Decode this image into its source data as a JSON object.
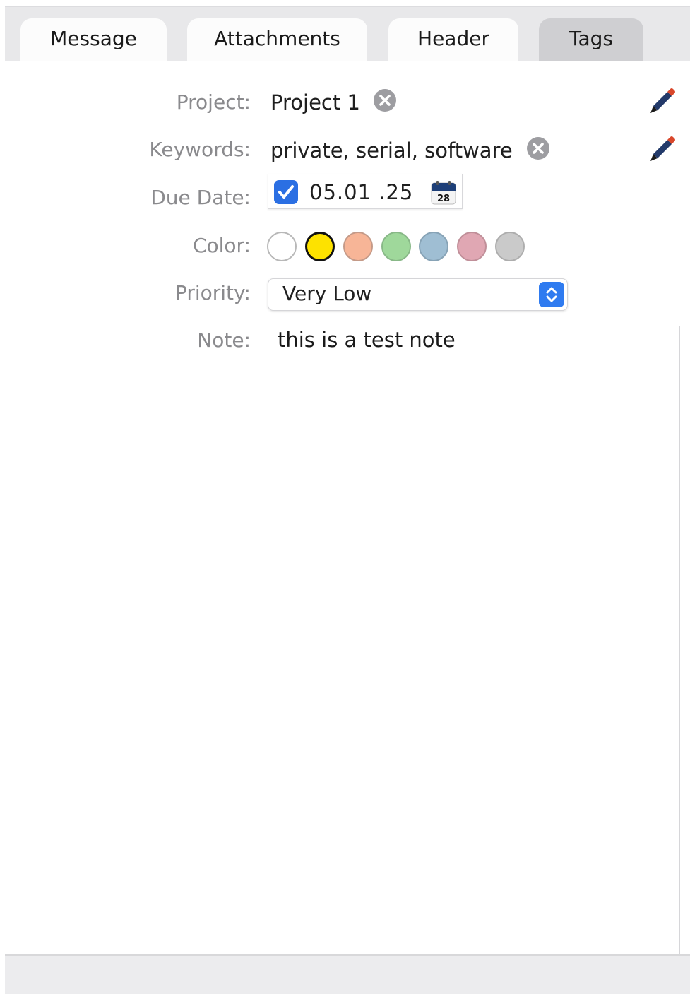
{
  "tabs": [
    {
      "label": "Message"
    },
    {
      "label": "Attachments"
    },
    {
      "label": "Header"
    },
    {
      "label": "Tags",
      "active": true
    }
  ],
  "fields": {
    "project_label": "Project:",
    "project_value": "Project 1",
    "keywords_label": "Keywords:",
    "keywords_value": "private, serial, software",
    "due_date_label": "Due Date:",
    "due_date_checked": true,
    "due_date_value": "05.01 .25",
    "calendar_icon_day": "28",
    "color_label": "Color:",
    "colors": [
      {
        "name": "none",
        "hex": "#ffffff"
      },
      {
        "name": "yellow",
        "hex": "#fde200",
        "selected": true
      },
      {
        "name": "orange",
        "hex": "#f7b597"
      },
      {
        "name": "green",
        "hex": "#9fd89b"
      },
      {
        "name": "blue",
        "hex": "#9fbed3"
      },
      {
        "name": "pink",
        "hex": "#e0a7b3"
      },
      {
        "name": "gray",
        "hex": "#cacaca"
      }
    ],
    "priority_label": "Priority:",
    "priority_value": "Very Low",
    "note_label": "Note:",
    "note_value": "this is a test note"
  },
  "icons": {
    "clear": "clear-circle-icon",
    "edit": "pencil-icon",
    "calendar": "calendar-icon",
    "check": "checkmark-icon",
    "stepper": "chevron-up-down-icon"
  },
  "accent_color": "#2b6fe3"
}
